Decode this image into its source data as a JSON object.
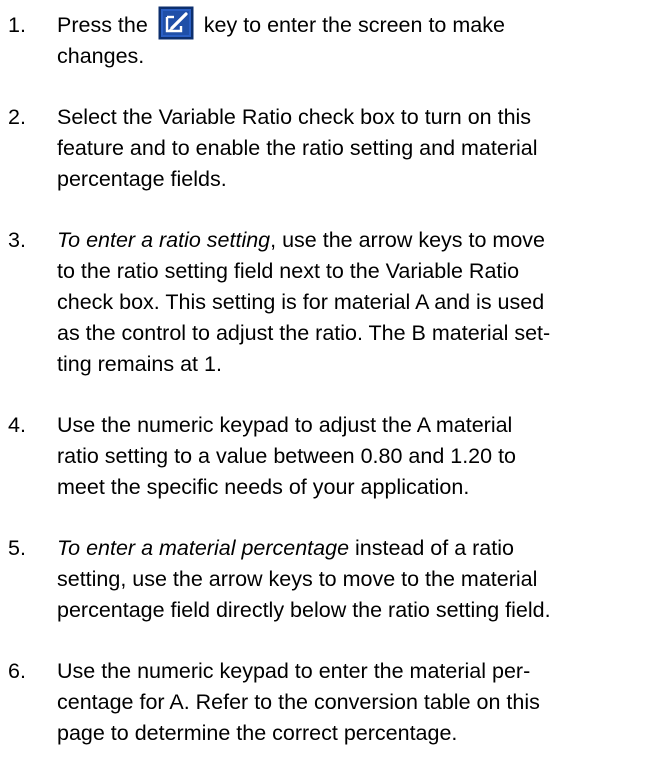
{
  "steps": [
    {
      "number": "1.",
      "prefix": "Press the",
      "icon": "edit-key-icon",
      "suffix": "key to enter the screen to make",
      "line2": "changes."
    },
    {
      "number": "2.",
      "lines": [
        "Select the Variable Ratio check box to turn on this",
        "feature and to enable the ratio setting and material",
        "percentage fields."
      ]
    },
    {
      "number": "3.",
      "italic_lead": "To enter a ratio setting",
      "lead_rest": ", use the arrow keys to move",
      "lines": [
        "to the ratio setting field next to the Variable Ratio",
        "check box. This setting is for material A and is used",
        "as the control to adjust the ratio. The B material set-",
        "ting remains at 1."
      ]
    },
    {
      "number": "4.",
      "lines": [
        "Use the numeric keypad to adjust the A material",
        "ratio setting to a value between 0.80 and 1.20 to",
        "meet the specific needs of your application."
      ]
    },
    {
      "number": "5.",
      "italic_lead": "To enter a material percentage",
      "lead_rest": " instead of a ratio",
      "lines": [
        "setting, use the arrow keys to move to the material",
        "percentage field directly below the ratio setting field."
      ]
    },
    {
      "number": "6.",
      "lines": [
        "Use the numeric keypad to enter the material per-",
        "centage for A. Refer to the conversion table on this",
        "page to determine the correct percentage."
      ]
    }
  ],
  "colors": {
    "edit_key_bg": "#1f4fa8",
    "edit_key_frame": "#0d2f6e",
    "edit_key_glyph": "#ffffff"
  }
}
